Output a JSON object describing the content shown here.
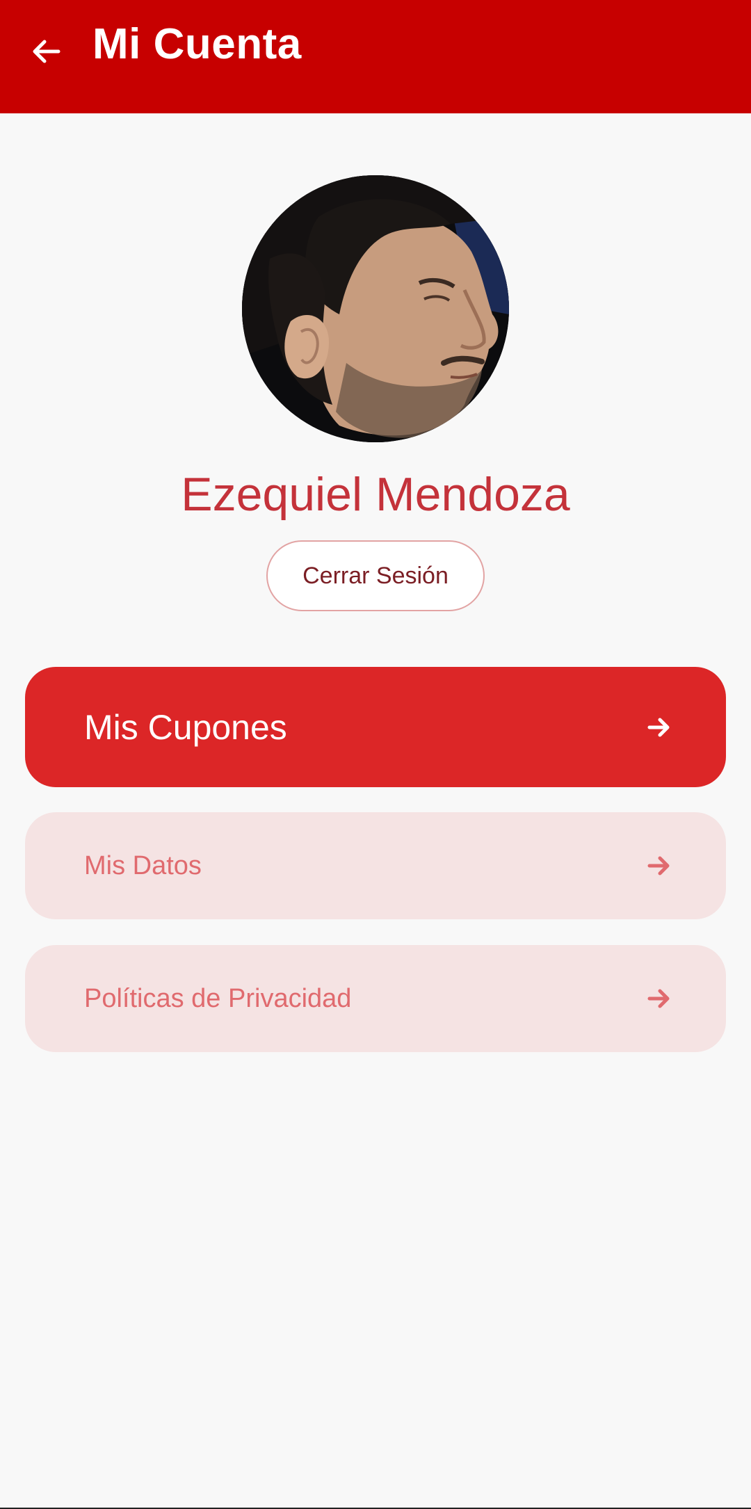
{
  "appbar": {
    "title": "Mi Cuenta",
    "back_icon": "arrow-back-icon",
    "background": "#c70000"
  },
  "profile": {
    "name": "Ezequiel Mendoza",
    "avatar_alt": "profile photo",
    "logout_label": "Cerrar Sesión"
  },
  "menu": {
    "items": [
      {
        "label": "Mis Cupones",
        "icon": "arrow-forward-icon",
        "style": "primary",
        "color": "#dc2627"
      },
      {
        "label": "Mis Datos",
        "icon": "arrow-forward-icon",
        "style": "secondary",
        "color": "#f5e3e3"
      },
      {
        "label": "Políticas de Privacidad",
        "icon": "arrow-forward-icon",
        "style": "secondary",
        "color": "#f5e3e3"
      }
    ]
  },
  "colors": {
    "accent": "#c70000",
    "name_text": "#c4323a",
    "secondary_text": "#e06a6e",
    "page_background": "#f8f8f8"
  }
}
